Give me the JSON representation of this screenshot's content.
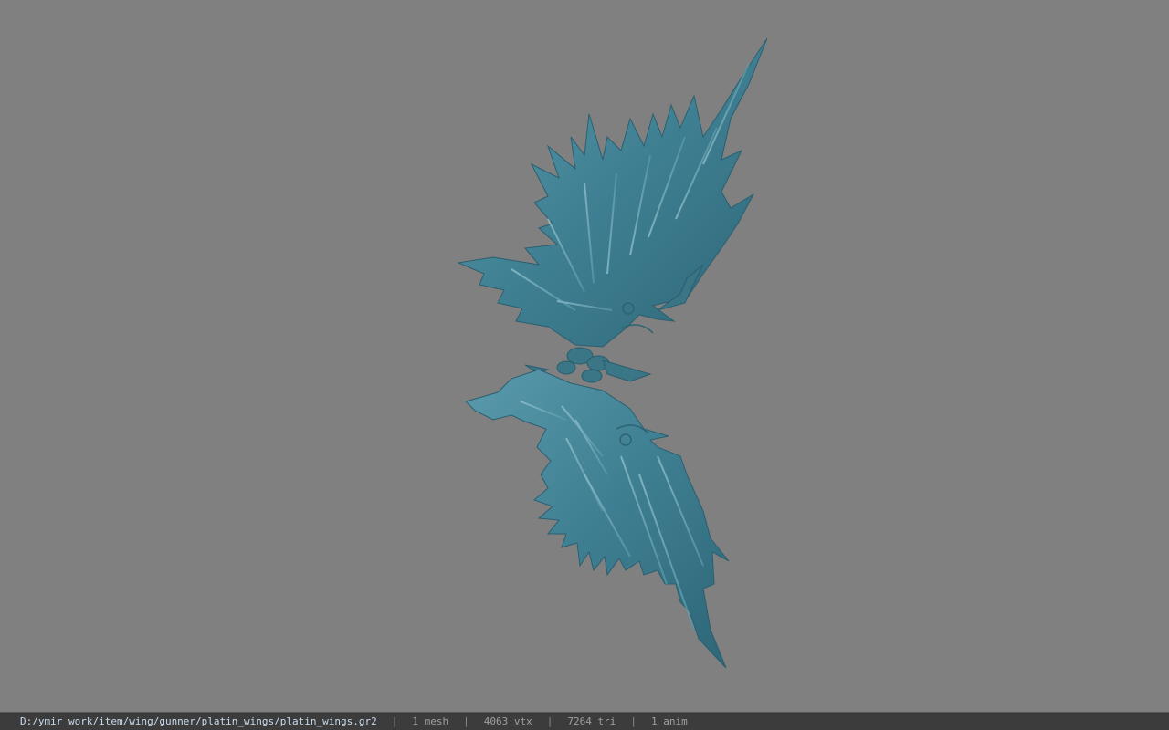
{
  "viewer": {
    "background_color": "#808080",
    "model_color": "#4a8a9c",
    "model_icon": "wing-model"
  },
  "status": {
    "path": "D:/ymir work/item/wing/gunner/platin_wings/platin_wings.gr2",
    "separator": "|",
    "mesh": "1 mesh",
    "vtx": "4063 vtx",
    "tri": "7264 tri",
    "anim": "1 anim"
  }
}
